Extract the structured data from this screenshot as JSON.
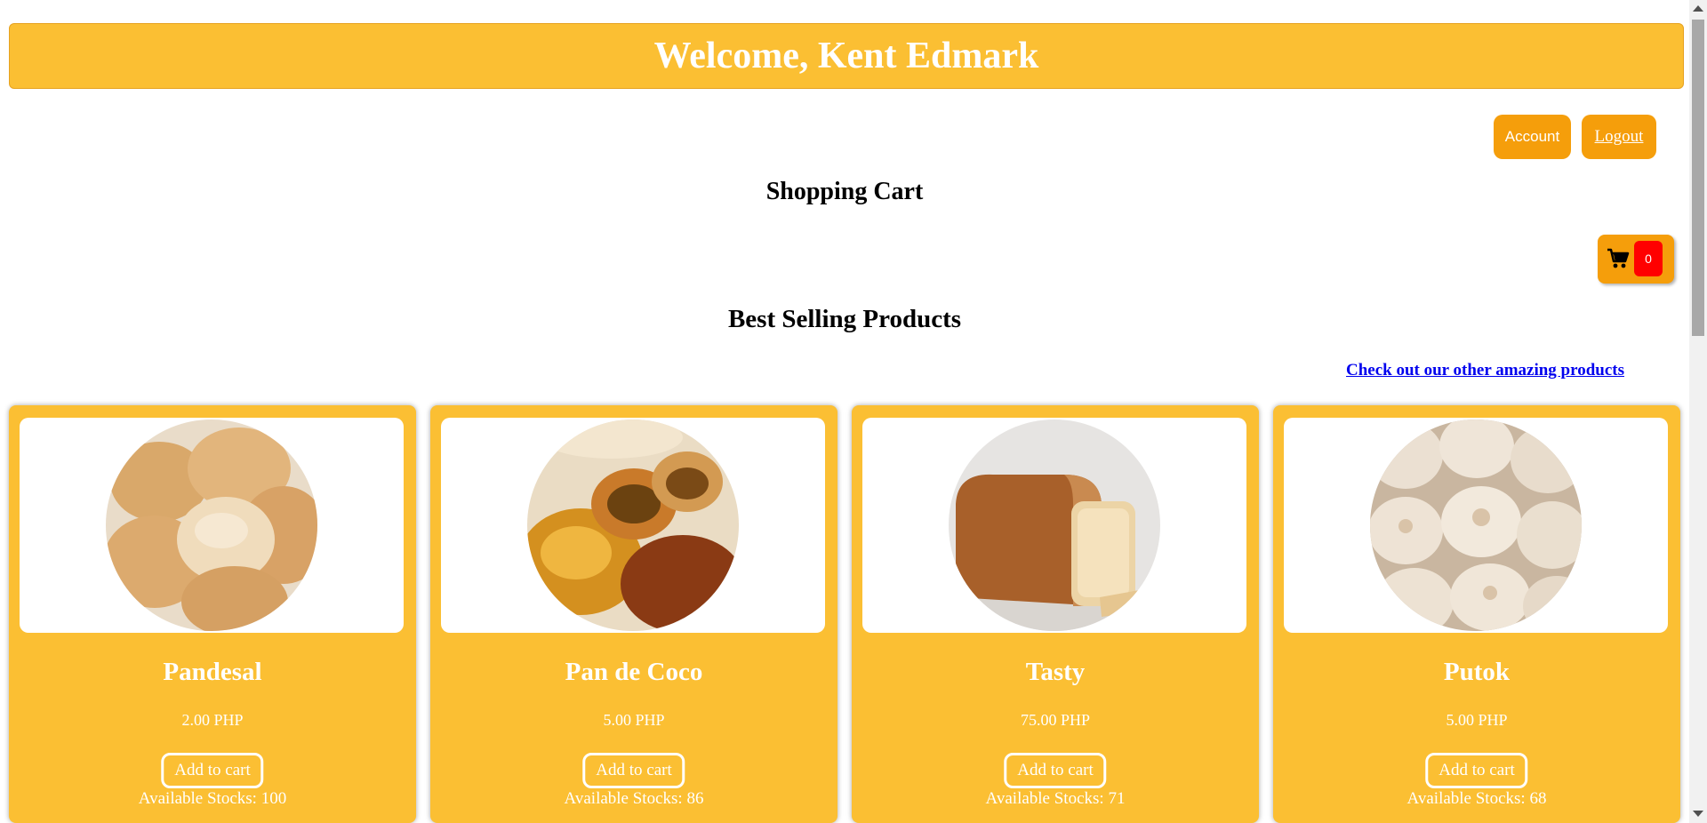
{
  "header": {
    "welcome_text": "Welcome, Kent Edmark"
  },
  "nav": {
    "account_label": "Account",
    "logout_label": "Logout"
  },
  "cart": {
    "title": "Shopping Cart",
    "count": "0",
    "icon": "cart-icon"
  },
  "best_selling": {
    "title": "Best Selling Products",
    "other_products_link": "Check out our other amazing products"
  },
  "products": [
    {
      "name": "Pandesal",
      "price": "2.00 PHP",
      "add_label": "Add to cart",
      "stock": "Available Stocks: 100"
    },
    {
      "name": "Pan de Coco",
      "price": "5.00 PHP",
      "add_label": "Add to cart",
      "stock": "Available Stocks: 86"
    },
    {
      "name": "Tasty",
      "price": "75.00 PHP",
      "add_label": "Add to cart",
      "stock": "Available Stocks: 71"
    },
    {
      "name": "Putok",
      "price": "5.00 PHP",
      "add_label": "Add to cart",
      "stock": "Available Stocks: 68"
    }
  ],
  "colors": {
    "accent": "#fbbf33",
    "button": "#f59e0b",
    "badge": "#ff0000",
    "link": "#0000ee"
  }
}
